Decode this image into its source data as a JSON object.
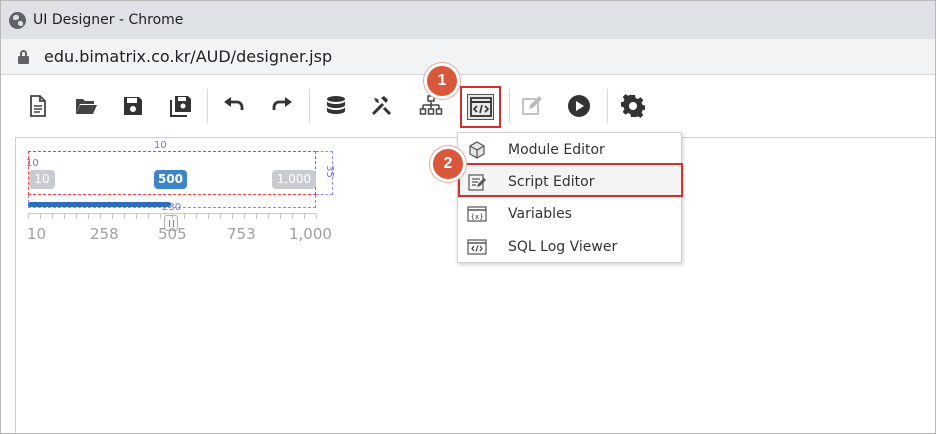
{
  "window": {
    "title": "UI Designer - Chrome"
  },
  "address": {
    "url": "edu.bimatrix.co.kr/AUD/designer.jsp"
  },
  "toolbar": {
    "buttons": [
      {
        "name": "new-document",
        "icon": "document-icon"
      },
      {
        "name": "open",
        "icon": "folder-open-icon"
      },
      {
        "name": "save",
        "icon": "save-icon"
      },
      {
        "name": "save-all",
        "icon": "save-all-icon"
      },
      {
        "name": "undo",
        "icon": "undo-icon"
      },
      {
        "name": "redo",
        "icon": "redo-icon"
      },
      {
        "name": "database",
        "icon": "database-icon"
      },
      {
        "name": "tools",
        "icon": "tools-icon"
      },
      {
        "name": "hierarchy",
        "icon": "hierarchy-icon"
      },
      {
        "name": "script-code",
        "icon": "code-icon"
      },
      {
        "name": "edit",
        "icon": "edit-icon"
      },
      {
        "name": "run",
        "icon": "play-icon"
      },
      {
        "name": "settings",
        "icon": "gear-icon"
      }
    ]
  },
  "slider": {
    "min_label": "10",
    "value_label": "500",
    "max_label": "1,000",
    "handle_value": 500,
    "min": 10,
    "max": 1000,
    "tick_labels": [
      "10",
      "258",
      "505",
      "753",
      "1,000"
    ],
    "dims": {
      "top": "10",
      "left": "10",
      "height": "35",
      "width": "230"
    }
  },
  "menu": {
    "items": [
      {
        "label": "Module Editor",
        "icon": "module-icon"
      },
      {
        "label": "Script Editor",
        "icon": "script-edit-icon"
      },
      {
        "label": "Variables",
        "icon": "variables-icon"
      },
      {
        "label": "SQL Log Viewer",
        "icon": "sql-log-icon"
      }
    ]
  },
  "badges": {
    "step1": "1",
    "step2": "2"
  },
  "colors": {
    "accent_red": "#d32f2f",
    "badge": "#d9583b",
    "slider_blue": "#3d85c6"
  }
}
